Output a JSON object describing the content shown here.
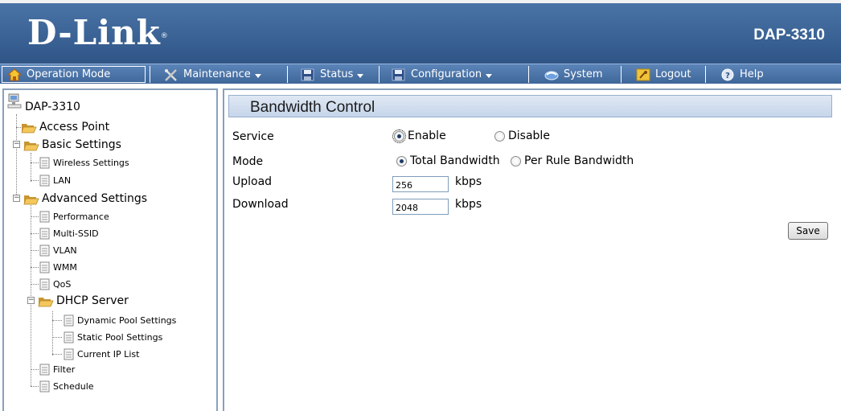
{
  "header": {
    "logo_text": "D-Link",
    "logo_mark": "®",
    "model": "DAP-3310"
  },
  "menu": {
    "items": [
      {
        "label": "Operation Mode",
        "icon": "house-icon",
        "dropdown": false
      },
      {
        "label": "Maintenance",
        "icon": "tools-icon",
        "dropdown": true
      },
      {
        "label": "Status",
        "icon": "floppy-disk-icon",
        "dropdown": true
      },
      {
        "label": "Configuration",
        "icon": "floppy-disk-icon",
        "dropdown": true
      },
      {
        "label": "System",
        "icon": "swirl-icon",
        "dropdown": false
      },
      {
        "label": "Logout",
        "icon": "logout-icon",
        "dropdown": false
      },
      {
        "label": "Help",
        "icon": "help-icon",
        "dropdown": false
      }
    ]
  },
  "tree": {
    "root": "DAP-3310",
    "access_point": "Access Point",
    "basic_settings": "Basic Settings",
    "wireless_settings": "Wireless Settings",
    "lan": "LAN",
    "advanced_settings": "Advanced Settings",
    "performance": "Performance",
    "multi_ssid": "Multi-SSID",
    "vlan": "VLAN",
    "wmm": "WMM",
    "qos": "QoS",
    "dhcp_server": "DHCP Server",
    "dynamic_pool": "Dynamic Pool Settings",
    "static_pool": "Static Pool Settings",
    "current_ip": "Current IP List",
    "filter": "Filter",
    "schedule": "Schedule",
    "expander_symbol": "−"
  },
  "main": {
    "title": "Bandwidth Control",
    "service": {
      "label": "Service",
      "enable": "Enable",
      "disable": "Disable",
      "selected": "Enable"
    },
    "mode": {
      "label": "Mode",
      "total": "Total Bandwidth",
      "per_rule": "Per Rule Bandwidth",
      "selected": "Total Bandwidth"
    },
    "upload": {
      "label": "Upload",
      "value": "256",
      "unit": "kbps"
    },
    "download": {
      "label": "Download",
      "value": "2048",
      "unit": "kbps"
    },
    "save_label": "Save"
  },
  "colors": {
    "header_blue": "#3d6597",
    "menu_blue": "#4b74a8",
    "panel_border": "#8a9fbc",
    "title_bar": "#d2deef"
  }
}
